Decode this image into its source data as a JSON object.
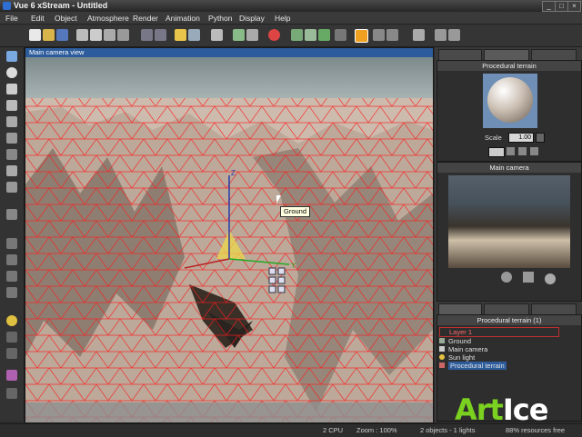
{
  "window": {
    "title": "Vue 6 xStream - Untitled"
  },
  "menu": [
    "File",
    "Edit",
    "Object",
    "Atmosphere",
    "Render",
    "Animation",
    "Python",
    "Display",
    "Help"
  ],
  "viewport": {
    "title": "Main camera view",
    "tooltip": "Ground"
  },
  "material_panel": {
    "title": "Procedural terrain",
    "scale_label": "Scale",
    "scale_value": "1.00"
  },
  "camera_panel": {
    "title": "Main camera"
  },
  "world_browser": {
    "title": "Procedural terrain (1)",
    "layer": "Layer 1",
    "items": [
      "Ground",
      "Main camera",
      "Sun light",
      "Procedural terrain"
    ],
    "selected_index": 3
  },
  "status": {
    "cpu": "2 CPU",
    "zoom": "Zoom : 100%",
    "objects": "2 objects - 1 lights",
    "resources": "88% resources free"
  },
  "watermark": {
    "part1": "Art",
    "part2": "Ice"
  },
  "colors": {
    "wireframe": "#ff1a1a",
    "selection_blue": "#2d5c9c",
    "watermark_green": "#7bd11f"
  }
}
